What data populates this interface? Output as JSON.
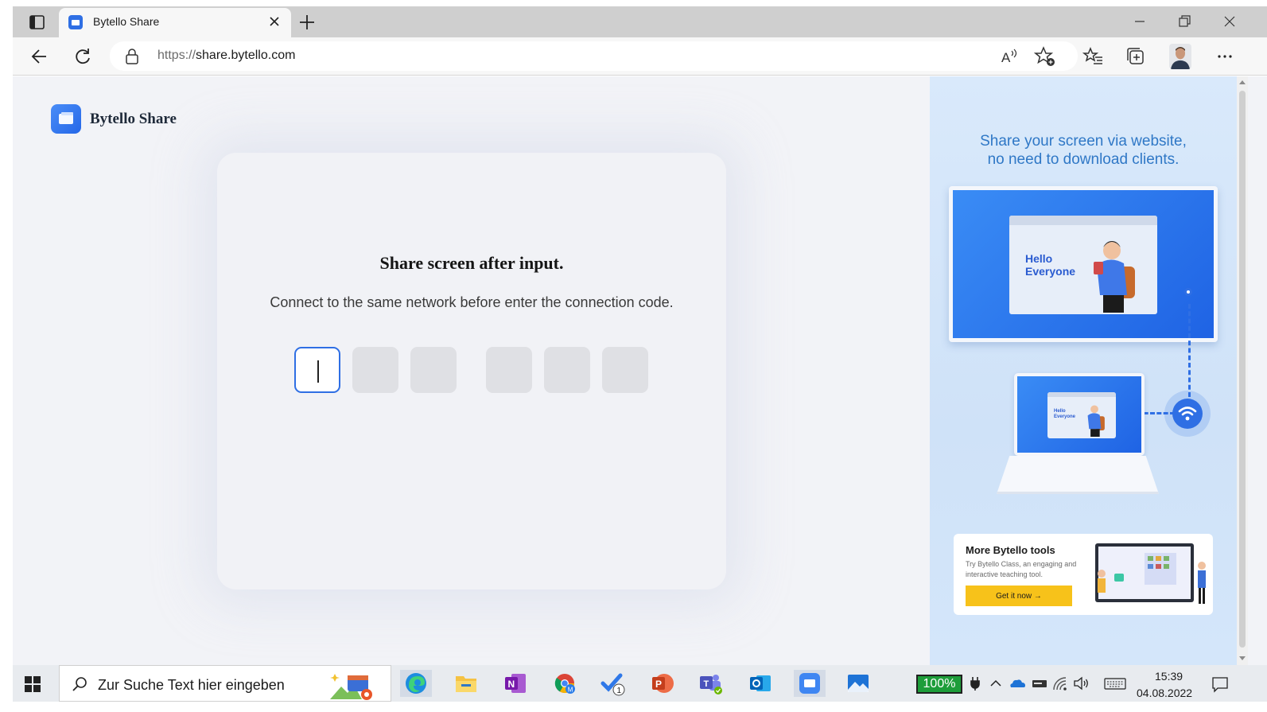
{
  "browser": {
    "tab_title": "Bytello Share",
    "url_scheme": "https://",
    "url_host": "share.bytello.com"
  },
  "page": {
    "logo_text": "Bytello Share",
    "card_title": "Share screen after input.",
    "card_subtitle": "Connect to the same network before enter the connection code.",
    "code_boxes": [
      "",
      "",
      "",
      "",
      "",
      ""
    ]
  },
  "right_panel": {
    "headline_1": "Share your screen via website,",
    "headline_2": "no need to download clients.",
    "monitor_text_1": "Hello",
    "monitor_text_2": "Everyone",
    "promo_title": "More Bytello tools",
    "promo_desc": "Try Bytello Class, an engaging and interactive teaching tool.",
    "promo_button": "Get it now →"
  },
  "taskbar": {
    "search_placeholder": "Zur Suche Text hier eingeben",
    "battery": "100%",
    "time": "15:39",
    "date": "04.08.2022",
    "apps": [
      "edge-icon",
      "file-explorer-icon",
      "onenote-icon",
      "chrome-icon",
      "todo-icon",
      "powerpoint-icon",
      "teams-icon",
      "outlook-icon",
      "bytello-icon",
      "photos-icon"
    ],
    "todo_badge": "1"
  },
  "colors": {
    "accent": "#2f6fe4",
    "panel_text": "#2f78c6",
    "promo_button": "#f7c21a",
    "battery_fill": "#1d9d3a"
  }
}
